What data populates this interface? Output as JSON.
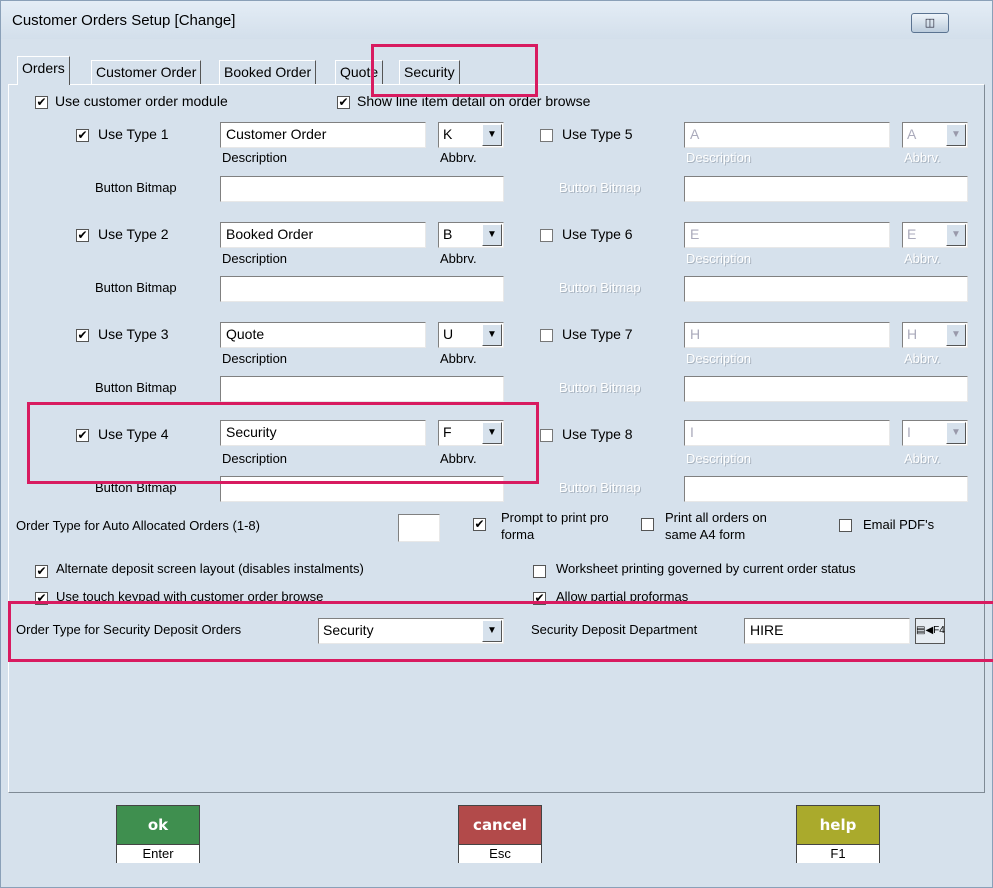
{
  "window": {
    "title": "Customer Orders Setup  [Change]",
    "restore_icon": "restore-icon"
  },
  "tabs": [
    "Orders",
    "Customer Order",
    "Booked Order",
    "Quote",
    "Security"
  ],
  "top_options": {
    "use_module": {
      "label": "Use customer order module",
      "checked": true
    },
    "show_line_detail": {
      "label": "Show line item detail on order browse",
      "checked": true
    }
  },
  "types_left": [
    {
      "label": "Use Type 1",
      "checked": true,
      "description": "Customer Order",
      "abbrv": "K"
    },
    {
      "label": "Use Type 2",
      "checked": true,
      "description": "Booked Order",
      "abbrv": "B"
    },
    {
      "label": "Use Type 3",
      "checked": true,
      "description": "Quote",
      "abbrv": "U"
    },
    {
      "label": "Use Type 4",
      "checked": true,
      "description": "Security",
      "abbrv": "F"
    }
  ],
  "types_right": [
    {
      "label": "Use Type 5",
      "checked": false,
      "description": "A",
      "abbrv": "A"
    },
    {
      "label": "Use Type 6",
      "checked": false,
      "description": "E",
      "abbrv": "E"
    },
    {
      "label": "Use Type 7",
      "checked": false,
      "description": "H",
      "abbrv": "H"
    },
    {
      "label": "Use Type 8",
      "checked": false,
      "description": "I",
      "abbrv": "I"
    }
  ],
  "field_labels": {
    "description": "Description",
    "abbrv": "Abbrv.",
    "button_bitmap": "Button Bitmap"
  },
  "auto_alloc": {
    "label": "Order Type for Auto Allocated Orders (1-8)",
    "value": ""
  },
  "prompt_pro_forma": {
    "label_1": "Prompt to print pro",
    "label_2": "forma",
    "checked": true
  },
  "print_all_orders": {
    "label_1": "Print all orders on",
    "label_2": "same A4 form",
    "checked": false
  },
  "email_pdf": {
    "label": "Email PDF's",
    "checked": false
  },
  "alt_deposit": {
    "label": "Alternate deposit screen layout (disables instalments)",
    "checked": true
  },
  "worksheet_printing": {
    "label": "Worksheet printing governed by current order status",
    "checked": false
  },
  "touch_keypad": {
    "label": "Use touch keypad with customer order browse",
    "checked": true
  },
  "allow_partial": {
    "label": "Allow partial proformas",
    "checked": true
  },
  "security_deposit": {
    "order_type_label": "Order Type for Security Deposit Orders",
    "order_type_value": "Security",
    "department_label": "Security Deposit Department",
    "department_value": "HIRE",
    "lookup_icon": "lookup-icon",
    "lookup_key": "F4"
  },
  "buttons": {
    "ok": {
      "label": "ok",
      "key": "Enter",
      "color": "#3f8f4f"
    },
    "cancel": {
      "label": "cancel",
      "key": "Esc",
      "color": "#b24a4a"
    },
    "help": {
      "label": "help",
      "key": "F1",
      "color": "#aaaa2c"
    }
  },
  "highlight_color": "#d81b60"
}
